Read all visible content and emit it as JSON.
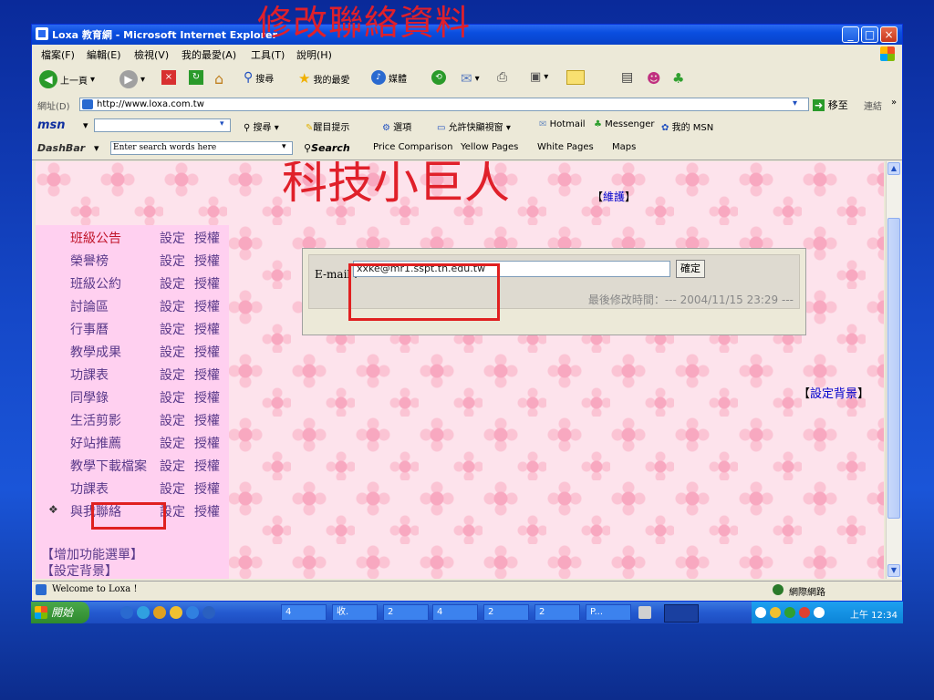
{
  "slide": {
    "title": "修改聯絡資料"
  },
  "window": {
    "title": "Loxa 教育網 - Microsoft Internet Explorer",
    "minimize": "_",
    "maximize": "□",
    "close": "×"
  },
  "menu": [
    "檔案(F)",
    "編輯(E)",
    "檢視(V)",
    "我的最愛(A)",
    "工具(T)",
    "說明(H)"
  ],
  "toolbar": {
    "back": "上一頁",
    "search": "搜尋",
    "favorites": "我的最愛",
    "media": "媒體"
  },
  "address": {
    "label": "網址(D)",
    "url": "http://www.loxa.com.tw",
    "go": "移至",
    "links": "連結"
  },
  "msn": {
    "logo": "msn",
    "search": "搜尋",
    "highlight": "醒目提示",
    "options": "選項",
    "popup": "允許快顯視窗",
    "hotmail": "Hotmail",
    "messenger": "Messenger",
    "mymsn": "我的 MSN"
  },
  "dashbar": {
    "logo": "DashBar",
    "placeholder": "Enter search words here",
    "search": "Search",
    "links": [
      "Price Comparison",
      "Yellow Pages",
      "White Pages",
      "Maps"
    ]
  },
  "site": {
    "title": "科技小巨人",
    "maintain_prefix": "【",
    "maintain": "維護",
    "maintain_suffix": "】"
  },
  "nav": {
    "set_label": "設定",
    "auth_label": "授權",
    "items": [
      "班級公告",
      "榮譽榜",
      "班級公約",
      "討論區",
      "行事曆",
      "教學成果",
      "功課表",
      "同學錄",
      "生活剪影",
      "好站推薦",
      "教學下載檔案",
      "功課表",
      "與我聯絡"
    ],
    "bullet": "❖",
    "add_menu": "【增加功能選單】",
    "set_bg": "【設定背景】"
  },
  "form": {
    "email_label": "E-mail :",
    "email_value": "xxke@mr1.sspt.tn.edu.tw",
    "confirm": "確定",
    "modified": "最後修改時間：---  2004/11/15 23:29  ---"
  },
  "right_link": {
    "prefix": "【",
    "label": "設定背景",
    "suffix": "】"
  },
  "status": {
    "text": "Welcome to Loxa !",
    "zone": "網際網路"
  },
  "taskbar": {
    "start": "開始",
    "items": [
      "4",
      "收.",
      "2",
      "4",
      "2",
      "2",
      "P..."
    ],
    "clock": "上午 12:34"
  }
}
